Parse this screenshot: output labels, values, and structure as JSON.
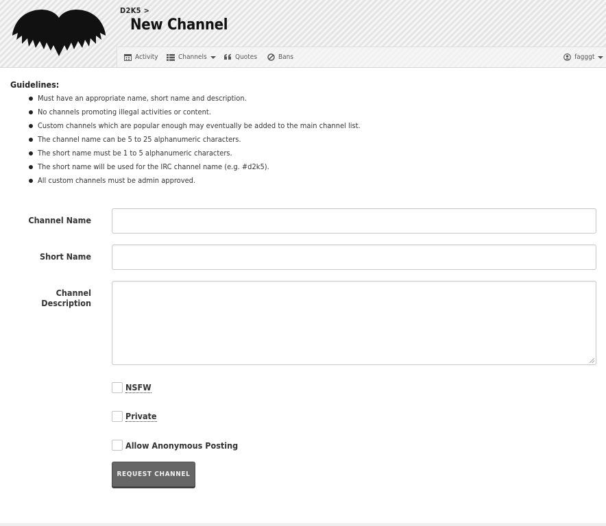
{
  "header": {
    "breadcrumb": "D2K5 >",
    "title": "New Channel",
    "logo_icon": "wings-logo-icon"
  },
  "nav": {
    "activity": {
      "label": "Activity",
      "icon": "calendar-icon"
    },
    "channels": {
      "label": "Channels",
      "icon": "list-icon"
    },
    "quotes": {
      "label": "Quotes",
      "icon": "quote-icon"
    },
    "bans": {
      "label": "Bans",
      "icon": "ban-icon"
    },
    "user": {
      "label": "fagggt",
      "icon": "user-circle-icon"
    }
  },
  "guidelines": {
    "title": "Guidelines:",
    "items": [
      "Must have an appropriate name, short name and description.",
      "No channels promoting illegal activities or content.",
      "Custom channels which are popular enough may eventually be added to the main channel list.",
      "The channel name can be 5 to 25 alphanumeric characters.",
      "The short name must be 1 to 5 alphanumeric characters.",
      "The short name will be used for the IRC channel name (e.g. #d2k5).",
      "All custom channels must be admin approved."
    ]
  },
  "form": {
    "channel_name_label": "Channel Name",
    "channel_name_value": "",
    "short_name_label": "Short Name",
    "short_name_value": "",
    "description_label": "Channel Description",
    "description_value": "",
    "nsfw_label": "NSFW",
    "private_label": "Private",
    "anon_label": "Allow Anonymous Posting",
    "submit_label": "REQUEST CHANNEL"
  },
  "colors": {
    "button_bg": "#666666",
    "header_bg": "#ececec"
  }
}
